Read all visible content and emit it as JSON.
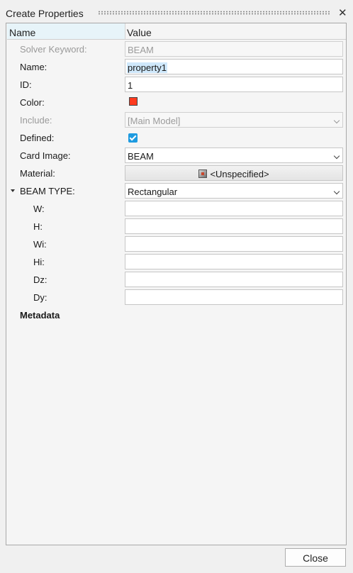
{
  "window": {
    "title": "Create Properties"
  },
  "header": {
    "name_col": "Name",
    "value_col": "Value"
  },
  "rows": {
    "solver_keyword": {
      "label": "Solver Keyword:",
      "value": "BEAM"
    },
    "name": {
      "label": "Name:",
      "value": "property1"
    },
    "id": {
      "label": "ID:",
      "value": "1"
    },
    "color": {
      "label": "Color:",
      "swatch": "#ff3b1f"
    },
    "include": {
      "label": "Include:",
      "value": "[Main Model]"
    },
    "defined": {
      "label": "Defined:",
      "checked": true
    },
    "card_image": {
      "label": "Card Image:",
      "value": "BEAM"
    },
    "material": {
      "label": "Material:",
      "value": "<Unspecified>",
      "icon": "material-cube-icon"
    },
    "beam_type": {
      "label": "BEAM TYPE:",
      "value": "Rectangular"
    },
    "w": {
      "label": "W:",
      "value": ""
    },
    "h": {
      "label": "H:",
      "value": ""
    },
    "wi": {
      "label": "Wi:",
      "value": ""
    },
    "hi": {
      "label": "Hi:",
      "value": ""
    },
    "dz": {
      "label": "Dz:",
      "value": ""
    },
    "dy": {
      "label": "Dy:",
      "value": ""
    },
    "metadata": {
      "label": "Metadata"
    }
  },
  "footer": {
    "close_label": "Close"
  }
}
